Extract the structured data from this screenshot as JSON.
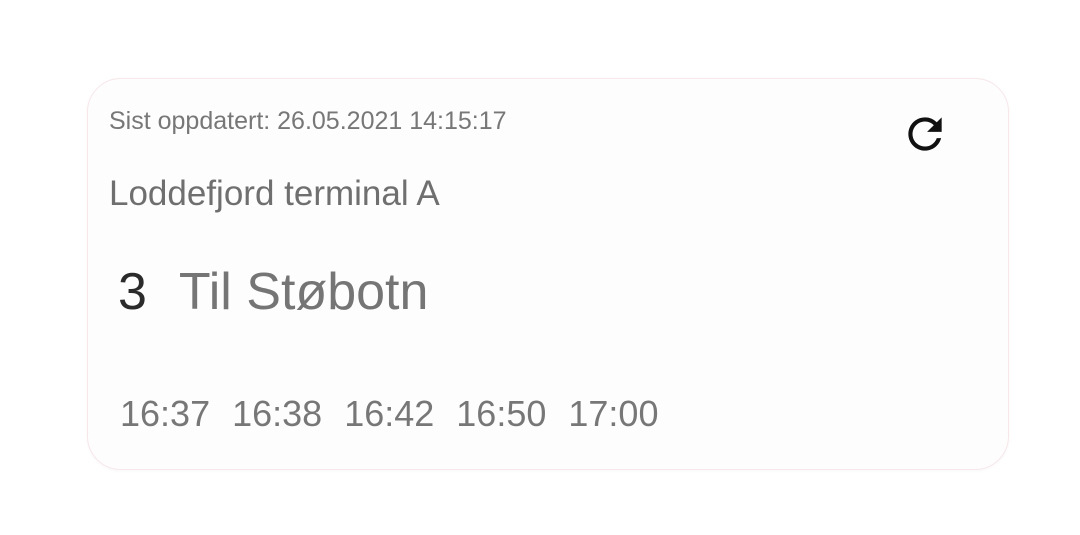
{
  "card": {
    "last_updated": "Sist oppdatert: 26.05.2021 14:15:17",
    "refresh_icon": "refresh-icon",
    "stop_name": "Loddefjord terminal A",
    "route": {
      "number": "3",
      "destination": "Til Støbotn"
    },
    "departures": [
      "16:37",
      "16:38",
      "16:42",
      "16:50",
      "17:00"
    ]
  }
}
